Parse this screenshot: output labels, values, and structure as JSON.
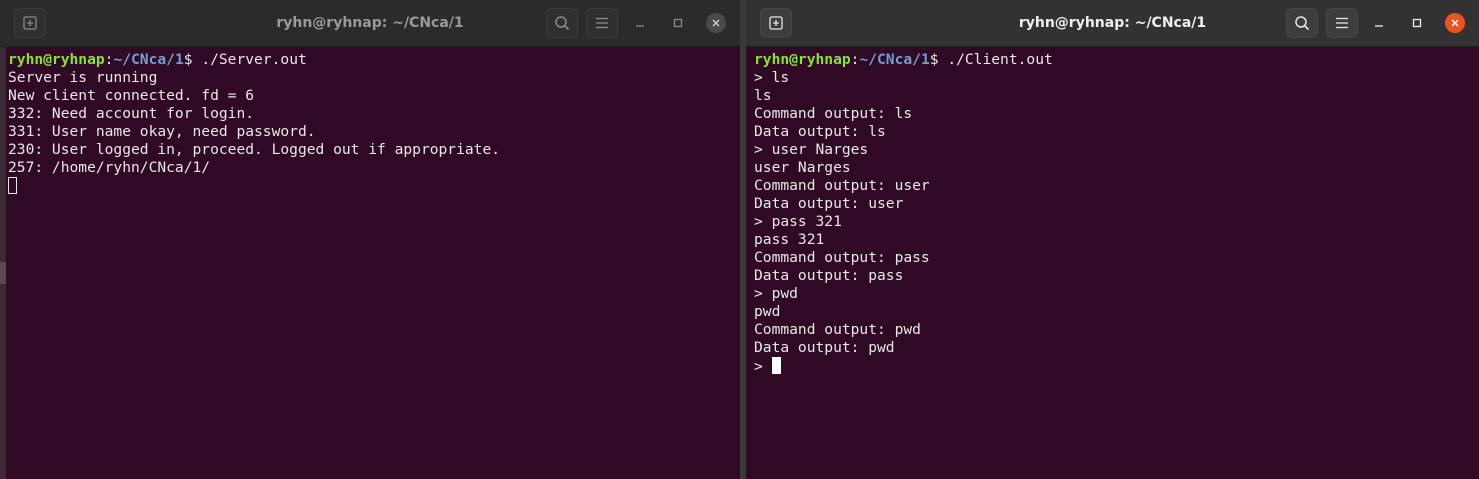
{
  "server_window": {
    "title": "ryhn@ryhnap: ~/CNca/1",
    "prompt_user": "ryhn@ryhnap",
    "prompt_sep": ":",
    "prompt_path": "~/CNca/1",
    "prompt_dollar": "$ ",
    "command": "./Server.out",
    "output": [
      "Server is running",
      "New client connected. fd = 6",
      "332: Need account for login.",
      "331: User name okay, need password.",
      "230: User logged in, proceed. Logged out if appropriate.",
      "257: /home/ryhn/CNca/1/"
    ]
  },
  "client_window": {
    "title": "ryhn@ryhnap: ~/CNca/1",
    "prompt_user": "ryhn@ryhnap",
    "prompt_sep": ":",
    "prompt_path": "~/CNca/1",
    "prompt_dollar": "$ ",
    "command": "./Client.out",
    "output": [
      "> ls",
      "ls",
      "Command output: ls",
      "Data output: ls",
      "> user Narges",
      "user Narges",
      "Command output: user",
      "Data output: user",
      "> pass 321",
      "pass 321",
      "Command output: pass",
      "Data output: pass",
      "> pwd",
      "pwd",
      "Command output: pwd",
      "Data output: pwd"
    ],
    "input_prompt": "> "
  },
  "icons": {
    "new_tab": "new-tab-icon",
    "search": "search-icon",
    "menu": "hamburger-menu-icon",
    "minimize": "minimize-icon",
    "maximize": "maximize-icon",
    "close": "close-icon"
  },
  "colors": {
    "terminal_bg": "#300a24",
    "prompt_user": "#8ae234",
    "prompt_path": "#729fcf",
    "close_active": "#e95420"
  }
}
